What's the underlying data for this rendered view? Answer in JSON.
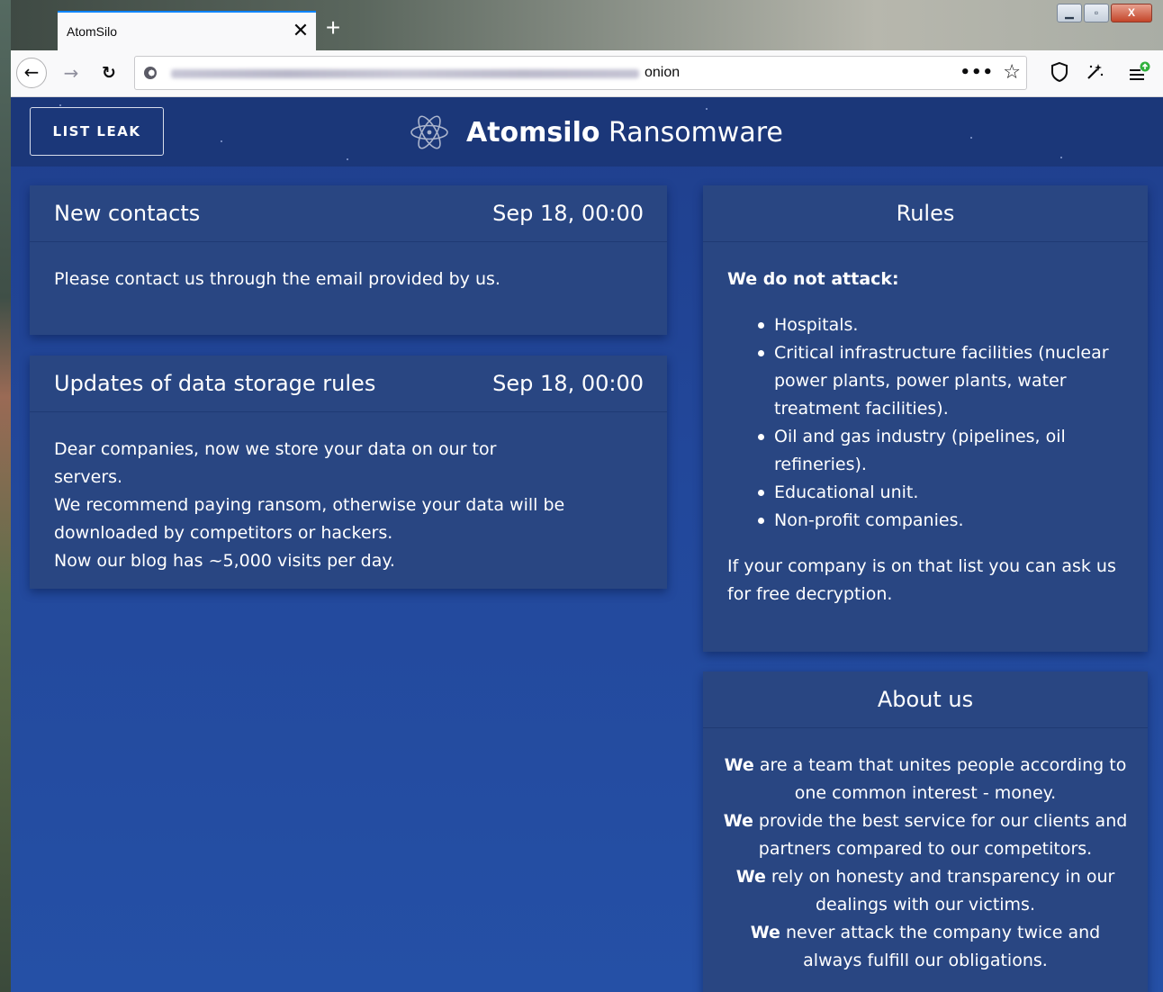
{
  "browser": {
    "tab_title": "AtomSilo",
    "tab_close": "✕",
    "new_tab": "+",
    "url_suffix": "onion",
    "window_buttons": [
      "▁",
      "▫",
      "X"
    ]
  },
  "header": {
    "list_leak_label": "LIST LEAK",
    "brand_bold": "Atomsilo",
    "brand_rest": " Ransomware"
  },
  "posts": [
    {
      "title": "New contacts",
      "date": "Sep 18, 00:00",
      "lines": [
        "Please contact us through the email provided by us."
      ]
    },
    {
      "title": "Updates of data storage rules",
      "date": "Sep 18, 00:00",
      "lines": [
        "Dear companies, now we store your data on our tor servers.",
        "We recommend paying ransom, otherwise your data will be downloaded by competitors or hackers.",
        "Now our blog has ~5,000 visits per day."
      ]
    }
  ],
  "rules": {
    "title": "Rules",
    "intro": "We do not attack:",
    "items": [
      "Hospitals.",
      "Critical infrastructure facilities (nuclear power plants, power plants, water treatment facilities).",
      "Oil and gas industry (pipelines, oil refineries).",
      "Educational unit.",
      "Non-profit companies."
    ],
    "footer": "If your company is on that list you can ask us for free decryption."
  },
  "about": {
    "title": "About us",
    "paragraphs": [
      {
        "bold": "We",
        "text": " are a team that unites people according to one common interest - money."
      },
      {
        "bold": "We",
        "text": " provide the best service for our clients and partners compared to our competitors."
      },
      {
        "bold": "We",
        "text": " rely on honesty and transparency in our dealings with our victims."
      },
      {
        "bold": "We",
        "text": " never attack the company twice and always fulfill our obligations."
      }
    ]
  },
  "colors": {
    "page_bg": "#22479a",
    "header_bg": "#1b3779",
    "card_bg": "#294682"
  }
}
